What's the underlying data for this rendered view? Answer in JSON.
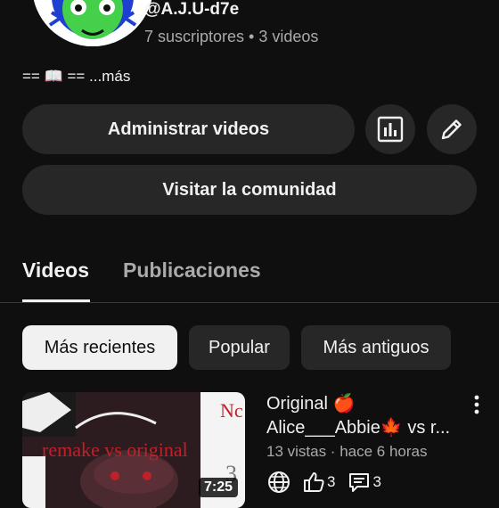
{
  "channel": {
    "handle": "@A.J.U-d7e",
    "stats": "7 suscriptores • 3 videos",
    "description": "== 📖 == ...más"
  },
  "actions": {
    "manage_videos": "Administrar videos",
    "visit_community": "Visitar la comunidad",
    "analytics_icon": "analytics-icon",
    "edit_icon": "pencil-icon"
  },
  "tabs": [
    {
      "label": "Videos",
      "active": true
    },
    {
      "label": "Publicaciones",
      "active": false
    }
  ],
  "filters": [
    {
      "label": "Más recientes",
      "active": true
    },
    {
      "label": "Popular",
      "active": false
    },
    {
      "label": "Más antiguos",
      "active": false
    }
  ],
  "video": {
    "title_line1": "Original 🍎",
    "title_line2": "Alice___Abbie🍁 vs r...",
    "meta": "13 vistas · hace 6 horas",
    "likes": "3",
    "comments": "3",
    "duration": "7:25",
    "thumb_text": "remake vs original",
    "thumb_corner": "Nc",
    "thumb_corner2": "3"
  },
  "colors": {
    "background": "#0f0f0f",
    "surface": "#272727",
    "text_primary": "#f1f1f1",
    "text_secondary": "#aaaaaa",
    "thumb_red": "#c0202a"
  }
}
